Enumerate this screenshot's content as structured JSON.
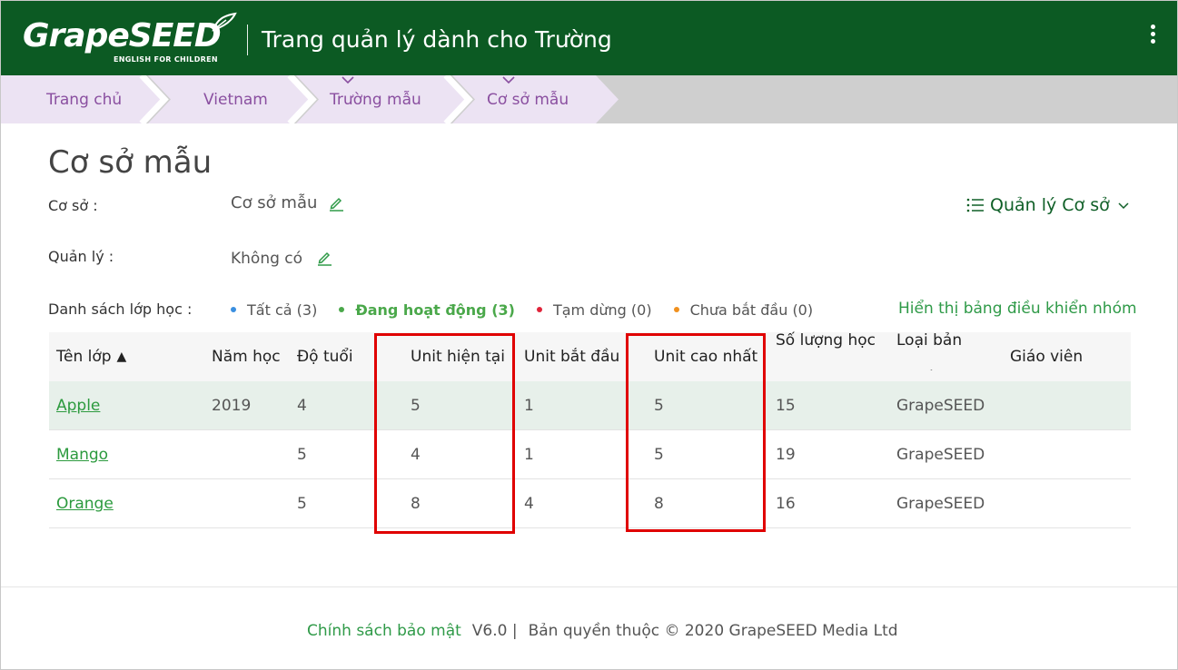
{
  "header": {
    "logo_text": "GrapeSEED",
    "logo_subtitle": "ENGLISH FOR CHILDREN",
    "title": "Trang quản lý dành cho Trường"
  },
  "breadcrumb": [
    {
      "label": "Trang chủ",
      "has_dropdown": false
    },
    {
      "label": "Vietnam",
      "has_dropdown": false
    },
    {
      "label": "Trường mẫu",
      "has_dropdown": true
    },
    {
      "label": "Cơ sở mẫu",
      "has_dropdown": true
    }
  ],
  "page": {
    "title": "Cơ sở mẫu",
    "campus_label": "Cơ sở :",
    "campus_value": "Cơ sở mẫu",
    "manager_label": "Quản lý :",
    "manager_value": "Không có",
    "manage_menu_label": "Quản lý Cơ sở",
    "class_list_label": "Danh sách lớp học :",
    "dashboard_link": "Hiển thị bảng điều khiển nhóm"
  },
  "filters": [
    {
      "label": "Tất cả",
      "count": "(3)",
      "color": "#3a8fe0",
      "active": false
    },
    {
      "label": "Đang hoạt động",
      "count": "(3)",
      "color": "#4aa84a",
      "active": true
    },
    {
      "label": "Tạm dừng",
      "count": "(0)",
      "color": "#e0243a",
      "active": false
    },
    {
      "label": "Chưa bắt đầu",
      "count": "(0)",
      "color": "#f0901e",
      "active": false
    }
  ],
  "table": {
    "columns": [
      "Tên lớp",
      "Năm học",
      "Độ tuổi",
      "Unit hiện tại",
      "Unit bắt đầu",
      "Unit cao nhất",
      "Số lượng học sinh",
      "Loại bản quyền",
      "Giáo viên"
    ],
    "sort_indicator": "▲",
    "rows": [
      {
        "name": "Apple",
        "year": "2019",
        "age": "4",
        "current_unit": "5",
        "start_unit": "1",
        "max_unit": "5",
        "students": "15",
        "license": "GrapeSEED",
        "teacher": ""
      },
      {
        "name": "Mango",
        "year": "",
        "age": "5",
        "current_unit": "4",
        "start_unit": "1",
        "max_unit": "5",
        "students": "19",
        "license": "GrapeSEED",
        "teacher": ""
      },
      {
        "name": "Orange",
        "year": "",
        "age": "5",
        "current_unit": "8",
        "start_unit": "4",
        "max_unit": "8",
        "students": "16",
        "license": "GrapeSEED",
        "teacher": ""
      }
    ]
  },
  "footer": {
    "privacy": "Chính sách bảo mật",
    "version": "V6.0 |",
    "copyright": "Bản quyền thuộc © 2020 GrapeSEED Media Ltd"
  },
  "colors": {
    "header_bg": "#0c5a23",
    "breadcrumb_bg": "#ece3f3",
    "breadcrumb_text": "#8a4fa0",
    "link_green": "#2c9a3e",
    "highlight_box": "#e00000"
  }
}
